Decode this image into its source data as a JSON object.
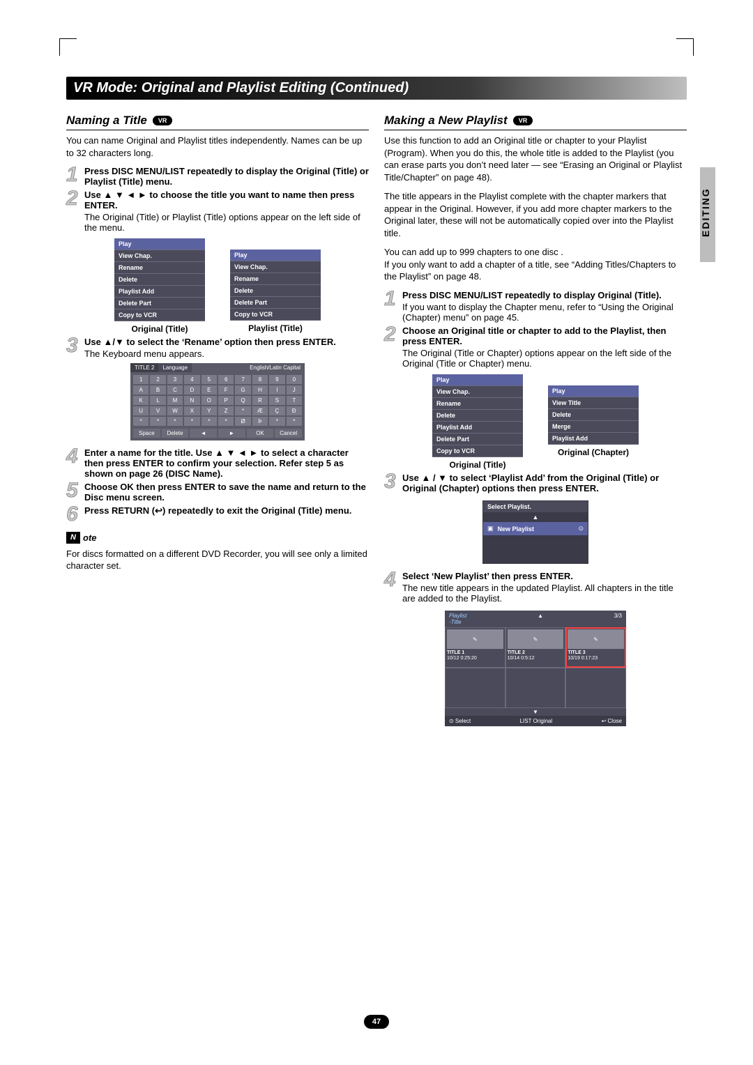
{
  "header": {
    "title": "VR Mode: Original and Playlist Editing (Continued)"
  },
  "side_tab": "EDITING",
  "page_number": "47",
  "left": {
    "section_title": "Naming a Title",
    "vr_label": "VR",
    "intro": "You can name Original and Playlist titles independently. Names can be up to 32 characters long.",
    "steps": {
      "s1": {
        "num": "1",
        "bold": "Press DISC MENU/LIST repeatedly to display the Original (Title) or Playlist (Title) menu."
      },
      "s2": {
        "num": "2",
        "bold": "Use ▲ ▼ ◄ ► to choose the title you want to name then press ENTER.",
        "plain": "The Original (Title) or Playlist (Title) options appear on the left side of the menu."
      },
      "s3": {
        "num": "3",
        "bold": "Use ▲/▼ to select the ‘Rename’ option then press ENTER.",
        "plain": "The Keyboard menu appears."
      },
      "s4": {
        "num": "4",
        "bold": "Enter a name for the title. Use ▲ ▼ ◄ ► to select a character then press ENTER to confirm your selection. Refer step 5 as shown on page 26 (DISC Name)."
      },
      "s5": {
        "num": "5",
        "bold": "Choose OK then press ENTER to save the name and return to the Disc menu screen."
      },
      "s6": {
        "num": "6",
        "bold": "Press RETURN (↩) repeatedly to exit the Original (Title) menu."
      }
    },
    "menus": {
      "original": {
        "caption": "Original (Title)",
        "items": [
          "Play",
          "View Chap.",
          "Rename",
          "Delete",
          "Playlist Add",
          "Delete Part",
          "Copy to VCR"
        ]
      },
      "playlist": {
        "caption": "Playlist (Title)",
        "items": [
          "Play",
          "View Chap.",
          "Rename",
          "Delete",
          "Delete Part",
          "Copy to VCR"
        ]
      }
    },
    "keyboard": {
      "title_field": "TITLE 2",
      "lang_label": "Language",
      "lang_value": "English/Latin Capital",
      "rows": [
        [
          "1",
          "2",
          "3",
          "4",
          "5",
          "6",
          "7",
          "8",
          "9",
          "0"
        ],
        [
          "A",
          "B",
          "C",
          "D",
          "E",
          "F",
          "G",
          "H",
          "I",
          "J"
        ],
        [
          "K",
          "L",
          "M",
          "N",
          "O",
          "P",
          "Q",
          "R",
          "S",
          "T"
        ],
        [
          "U",
          "V",
          "W",
          "X",
          "Y",
          "Z",
          "*",
          "Æ",
          "Ç",
          "Ð"
        ],
        [
          "*",
          "*",
          "*",
          "*",
          "*",
          "*",
          "Ø",
          "Þ",
          "*",
          "*"
        ]
      ],
      "bottom": [
        "Space",
        "Delete",
        "◄",
        "►",
        "OK",
        "Cancel"
      ]
    },
    "note": {
      "label_n": "N",
      "label_rest": "ote",
      "body": "For discs formatted on a different DVD Recorder, you will see only a limited character set."
    }
  },
  "right": {
    "section_title": "Making a New Playlist",
    "vr_label": "VR",
    "para1": "Use this function to add an Original title or chapter to your Playlist (Program). When you do this, the whole title is added to the Playlist (you can erase parts you don’t need later — see “Erasing an Original or Playlist Title/Chapter” on page 48).",
    "para2": "The title appears in the Playlist complete with the chapter markers that appear in the Original. However, if you add more chapter markers to the Original later, these will not be automatically copied over into the Playlist title.",
    "para3a": "You can add up to 999 chapters to one disc .",
    "para3b": "If you only want to add a chapter of a title, see “Adding Titles/Chapters to the Playlist” on page 48.",
    "steps": {
      "s1": {
        "num": "1",
        "bold": "Press DISC MENU/LIST repeatedly to display Original (Title).",
        "plain": "If you want to display the Chapter menu, refer to “Using the Original (Chapter) menu” on page 45."
      },
      "s2": {
        "num": "2",
        "bold": "Choose an Original title or chapter to add to the Playlist, then press ENTER.",
        "plain": "The Original (Title or Chapter) options appear on the left side of the Original (Title or Chapter) menu."
      },
      "s3": {
        "num": "3",
        "bold": "Use ▲ / ▼ to select ‘Playlist Add’ from the Original (Title) or Original (Chapter) options then press ENTER."
      },
      "s4": {
        "num": "4",
        "bold": "Select ‘New Playlist’ then press ENTER.",
        "plain": "The new title appears in the updated Playlist. All chapters in the title are added to the Playlist."
      }
    },
    "menus": {
      "original_title": {
        "caption": "Original (Title)",
        "items": [
          "Play",
          "View Chap.",
          "Rename",
          "Delete",
          "Playlist Add",
          "Delete Part",
          "Copy to VCR"
        ]
      },
      "original_chapter": {
        "caption": "Original (Chapter)",
        "items": [
          "Play",
          "View Title",
          "Delete",
          "Merge",
          "Playlist Add"
        ]
      }
    },
    "select_playlist": {
      "header": "Select Playlist.",
      "row_label": "New Playlist",
      "row_icon": "▣",
      "row_arrow": "⊙"
    },
    "playlist_screen": {
      "label": "Playlist",
      "sublabel": "-Title",
      "counter": "3/3",
      "tiles": [
        {
          "title": "TITLE 1",
          "meta": "10/12   0:25:20"
        },
        {
          "title": "TITLE 2",
          "meta": "10/14   0:5:12"
        },
        {
          "title": "TITLE 3",
          "meta": "10/19   0:17:23"
        }
      ],
      "bottom": {
        "select": "⊙ Select",
        "mid": "LIST Original",
        "close": "↩ Close"
      }
    }
  }
}
